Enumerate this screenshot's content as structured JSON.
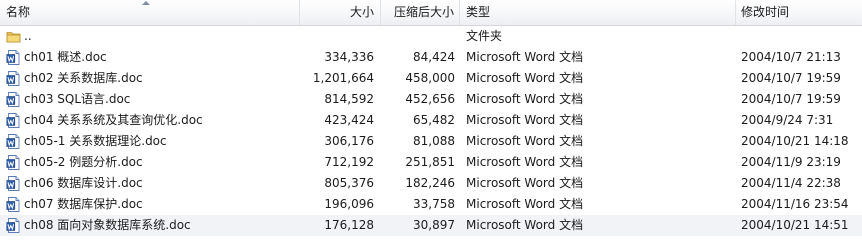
{
  "columns": {
    "name": "名称",
    "size": "大小",
    "compressed": "压缩后大小",
    "type": "类型",
    "modified": "修改时间"
  },
  "rows": [
    {
      "name": "..",
      "size": "",
      "compressed": "",
      "type": "文件夹",
      "modified": "",
      "icon": "folder-icon"
    },
    {
      "name": "ch01 概述.doc",
      "size": "334,336",
      "compressed": "84,424",
      "type": "Microsoft Word 文档",
      "modified": "2004/10/7 21:13",
      "icon": "word-doc-icon"
    },
    {
      "name": "ch02 关系数据库.doc",
      "size": "1,201,664",
      "compressed": "458,000",
      "type": "Microsoft Word 文档",
      "modified": "2004/10/7 19:59",
      "icon": "word-doc-icon"
    },
    {
      "name": "ch03 SQL语言.doc",
      "size": "814,592",
      "compressed": "452,656",
      "type": "Microsoft Word 文档",
      "modified": "2004/10/7 19:59",
      "icon": "word-doc-icon"
    },
    {
      "name": "ch04 关系系统及其查询优化.doc",
      "size": "423,424",
      "compressed": "65,482",
      "type": "Microsoft Word 文档",
      "modified": "2004/9/24 7:31",
      "icon": "word-doc-icon"
    },
    {
      "name": "ch05-1 关系数据理论.doc",
      "size": "306,176",
      "compressed": "81,088",
      "type": "Microsoft Word 文档",
      "modified": "2004/10/21 14:18",
      "icon": "word-doc-icon"
    },
    {
      "name": "ch05-2 例题分析.doc",
      "size": "712,192",
      "compressed": "251,851",
      "type": "Microsoft Word 文档",
      "modified": "2004/11/9 23:19",
      "icon": "word-doc-icon"
    },
    {
      "name": "ch06 数据库设计.doc",
      "size": "805,376",
      "compressed": "182,246",
      "type": "Microsoft Word 文档",
      "modified": "2004/11/4 22:38",
      "icon": "word-doc-icon"
    },
    {
      "name": "ch07 数据库保护.doc",
      "size": "196,096",
      "compressed": "33,758",
      "type": "Microsoft Word 文档",
      "modified": "2004/11/16 23:54",
      "icon": "word-doc-icon"
    },
    {
      "name": "ch08 面向对象数据库系统.doc",
      "size": "176,128",
      "compressed": "30,897",
      "type": "Microsoft Word 文档",
      "modified": "2004/10/21 14:51",
      "icon": "word-doc-icon"
    }
  ]
}
